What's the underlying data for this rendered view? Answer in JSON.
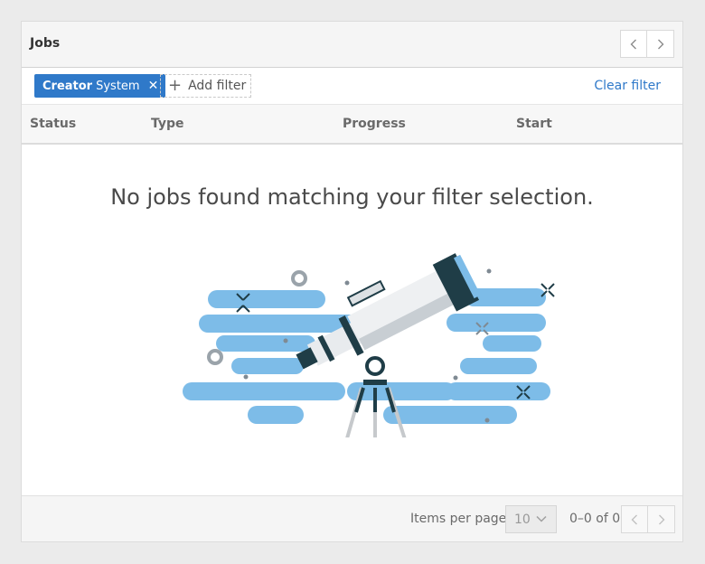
{
  "header": {
    "title": "Jobs"
  },
  "filters": {
    "chips": [
      {
        "key": "Creator",
        "value": "System"
      }
    ],
    "add_label": "Add filter",
    "clear_label": "Clear filter"
  },
  "table": {
    "columns": [
      "Status",
      "Type",
      "Progress",
      "Start"
    ],
    "empty_message": "No jobs found matching your filter selection."
  },
  "footer": {
    "items_per_page_label": "Items per page",
    "items_per_page_value": "10",
    "range": "0–0 of 0"
  },
  "colors": {
    "accent": "#2f79c9",
    "cloud": "#7dbce8",
    "telescope_dark": "#1f3d47"
  }
}
